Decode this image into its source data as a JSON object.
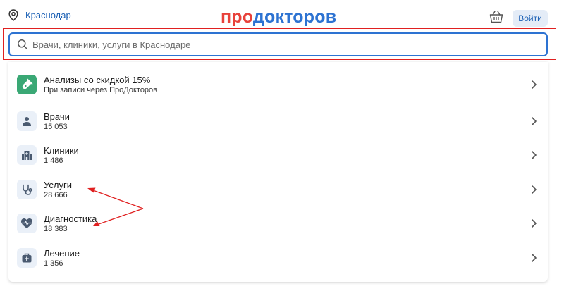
{
  "header": {
    "city": "Краснодар",
    "logo_part1": "про",
    "logo_part2": "докторов",
    "login_label": "Войти"
  },
  "search": {
    "placeholder": "Врачи, клиники, услуги в Краснодаре"
  },
  "items": [
    {
      "title": "Анализы со скидкой 15%",
      "subtitle": "При записи через ПроДокторов",
      "icon": "test-tube-icon"
    },
    {
      "title": "Врачи",
      "subtitle": "15 053",
      "icon": "doctor-icon"
    },
    {
      "title": "Клиники",
      "subtitle": "1 486",
      "icon": "clinic-building-icon"
    },
    {
      "title": "Услуги",
      "subtitle": "28 666",
      "icon": "stethoscope-icon"
    },
    {
      "title": "Диагностика",
      "subtitle": "18 383",
      "icon": "heart-pulse-icon"
    },
    {
      "title": "Лечение",
      "subtitle": "1 356",
      "icon": "medkit-icon"
    }
  ],
  "colors": {
    "accent_blue": "#2d73d2",
    "logo_red": "#e8413a",
    "promo_green": "#3aa875",
    "annotation_red": "#e02020",
    "icon_slate": "#4a5a70"
  }
}
